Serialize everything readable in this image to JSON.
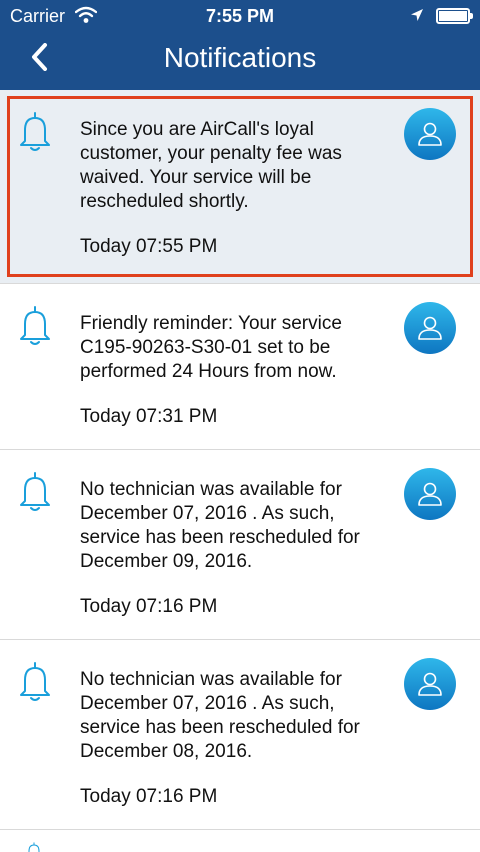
{
  "status_bar": {
    "carrier": "Carrier",
    "time": "7:55 PM",
    "battery_level": 1.0
  },
  "header": {
    "title": "Notifications"
  },
  "colors": {
    "header_bg": "#1c4f8c",
    "accent": "#1a9fdb",
    "selection_border": "#e0401c",
    "selected_bg": "#e9eef3"
  },
  "icons": {
    "back": "chevron-left-icon",
    "bell": "bell-icon",
    "avatar": "user-avatar-icon"
  },
  "notifications": [
    {
      "lines": [
        "Since you are AirCall's loyal",
        "customer, your penalty fee was",
        "waived. Your service will be",
        "rescheduled shortly."
      ],
      "time": "Today 07:55 PM",
      "selected": true
    },
    {
      "lines": [
        "Friendly reminder: Your service",
        "C195-90263-S30-01 set to be",
        "performed 24 Hours from now."
      ],
      "time": "Today 07:31 PM",
      "selected": false
    },
    {
      "lines": [
        "No technician was available for",
        "December 07, 2016 . As such,",
        "service has been rescheduled for",
        "December 09, 2016."
      ],
      "time": "Today 07:16 PM",
      "selected": false
    },
    {
      "lines": [
        "No technician was available for",
        "December 07, 2016 . As such,",
        "service has been rescheduled for",
        "December 08, 2016."
      ],
      "time": "Today 07:16 PM",
      "selected": false
    }
  ]
}
